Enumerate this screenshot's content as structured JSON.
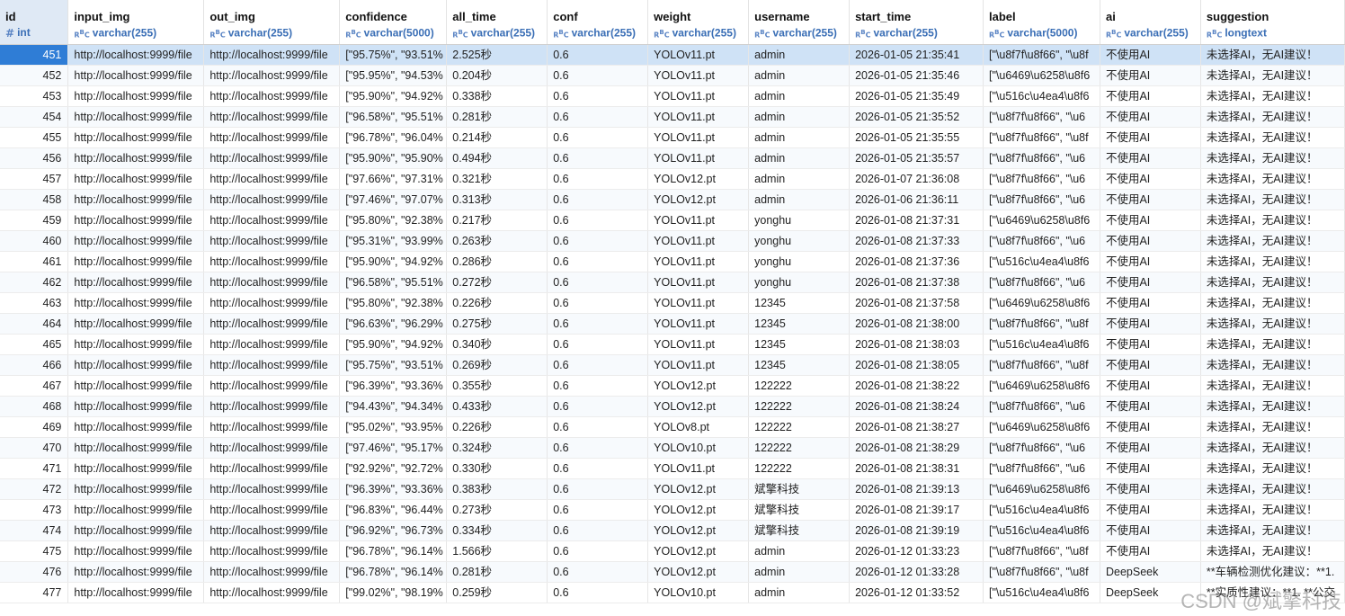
{
  "columns": [
    {
      "key": "id",
      "name": "id",
      "type": "int",
      "icon": "number-icon"
    },
    {
      "key": "input_img",
      "name": "input_img",
      "type": "varchar(255)",
      "icon": "text-type-icon"
    },
    {
      "key": "out_img",
      "name": "out_img",
      "type": "varchar(255)",
      "icon": "text-type-icon"
    },
    {
      "key": "confidence",
      "name": "confidence",
      "type": "varchar(5000)",
      "icon": "text-type-icon"
    },
    {
      "key": "all_time",
      "name": "all_time",
      "type": "varchar(255)",
      "icon": "text-type-icon"
    },
    {
      "key": "conf",
      "name": "conf",
      "type": "varchar(255)",
      "icon": "text-type-icon"
    },
    {
      "key": "weight",
      "name": "weight",
      "type": "varchar(255)",
      "icon": "text-type-icon"
    },
    {
      "key": "username",
      "name": "username",
      "type": "varchar(255)",
      "icon": "text-type-icon"
    },
    {
      "key": "start_time",
      "name": "start_time",
      "type": "varchar(255)",
      "icon": "text-type-icon"
    },
    {
      "key": "label",
      "name": "label",
      "type": "varchar(5000)",
      "icon": "text-type-icon"
    },
    {
      "key": "ai",
      "name": "ai",
      "type": "varchar(255)",
      "icon": "text-type-icon"
    },
    {
      "key": "suggestion",
      "name": "suggestion",
      "type": "longtext",
      "icon": "text-type-icon"
    }
  ],
  "selected_row_id": "451",
  "rows": [
    {
      "id": "451",
      "input_img": "http://localhost:9999/file",
      "out_img": "http://localhost:9999/file",
      "confidence": "[\"95.75%\", \"93.51%",
      "all_time": "2.525秒",
      "conf": "0.6",
      "weight": "YOLOv11.pt",
      "username": "admin",
      "start_time": "2026-01-05 21:35:41",
      "label": "[\"\\u8f7f\\u8f66\", \"\\u8f",
      "ai": "不使用AI",
      "suggestion": "未选择AI，无AI建议！"
    },
    {
      "id": "452",
      "input_img": "http://localhost:9999/file",
      "out_img": "http://localhost:9999/file",
      "confidence": "[\"95.95%\", \"94.53%",
      "all_time": "0.204秒",
      "conf": "0.6",
      "weight": "YOLOv11.pt",
      "username": "admin",
      "start_time": "2026-01-05 21:35:46",
      "label": "[\"\\u6469\\u6258\\u8f6",
      "ai": "不使用AI",
      "suggestion": "未选择AI，无AI建议！"
    },
    {
      "id": "453",
      "input_img": "http://localhost:9999/file",
      "out_img": "http://localhost:9999/file",
      "confidence": "[\"95.90%\", \"94.92%",
      "all_time": "0.338秒",
      "conf": "0.6",
      "weight": "YOLOv11.pt",
      "username": "admin",
      "start_time": "2026-01-05 21:35:49",
      "label": "[\"\\u516c\\u4ea4\\u8f6",
      "ai": "不使用AI",
      "suggestion": "未选择AI，无AI建议！"
    },
    {
      "id": "454",
      "input_img": "http://localhost:9999/file",
      "out_img": "http://localhost:9999/file",
      "confidence": "[\"96.58%\", \"95.51%",
      "all_time": "0.281秒",
      "conf": "0.6",
      "weight": "YOLOv11.pt",
      "username": "admin",
      "start_time": "2026-01-05 21:35:52",
      "label": "[\"\\u8f7f\\u8f66\", \"\\u6",
      "ai": "不使用AI",
      "suggestion": "未选择AI，无AI建议！"
    },
    {
      "id": "455",
      "input_img": "http://localhost:9999/file",
      "out_img": "http://localhost:9999/file",
      "confidence": "[\"96.78%\", \"96.04%",
      "all_time": "0.214秒",
      "conf": "0.6",
      "weight": "YOLOv11.pt",
      "username": "admin",
      "start_time": "2026-01-05 21:35:55",
      "label": "[\"\\u8f7f\\u8f66\", \"\\u8f",
      "ai": "不使用AI",
      "suggestion": "未选择AI，无AI建议！"
    },
    {
      "id": "456",
      "input_img": "http://localhost:9999/file",
      "out_img": "http://localhost:9999/file",
      "confidence": "[\"95.90%\", \"95.90%",
      "all_time": "0.494秒",
      "conf": "0.6",
      "weight": "YOLOv11.pt",
      "username": "admin",
      "start_time": "2026-01-05 21:35:57",
      "label": "[\"\\u8f7f\\u8f66\", \"\\u6",
      "ai": "不使用AI",
      "suggestion": "未选择AI，无AI建议！"
    },
    {
      "id": "457",
      "input_img": "http://localhost:9999/file",
      "out_img": "http://localhost:9999/file",
      "confidence": "[\"97.66%\", \"97.31%",
      "all_time": "0.321秒",
      "conf": "0.6",
      "weight": "YOLOv12.pt",
      "username": "admin",
      "start_time": "2026-01-07 21:36:08",
      "label": "[\"\\u8f7f\\u8f66\", \"\\u6",
      "ai": "不使用AI",
      "suggestion": "未选择AI，无AI建议！"
    },
    {
      "id": "458",
      "input_img": "http://localhost:9999/file",
      "out_img": "http://localhost:9999/file",
      "confidence": "[\"97.46%\", \"97.07%",
      "all_time": "0.313秒",
      "conf": "0.6",
      "weight": "YOLOv12.pt",
      "username": "admin",
      "start_time": "2026-01-06 21:36:11",
      "label": "[\"\\u8f7f\\u8f66\", \"\\u6",
      "ai": "不使用AI",
      "suggestion": "未选择AI，无AI建议！"
    },
    {
      "id": "459",
      "input_img": "http://localhost:9999/file",
      "out_img": "http://localhost:9999/file",
      "confidence": "[\"95.80%\", \"92.38%",
      "all_time": "0.217秒",
      "conf": "0.6",
      "weight": "YOLOv11.pt",
      "username": "yonghu",
      "start_time": "2026-01-08 21:37:31",
      "label": "[\"\\u6469\\u6258\\u8f6",
      "ai": "不使用AI",
      "suggestion": "未选择AI，无AI建议！"
    },
    {
      "id": "460",
      "input_img": "http://localhost:9999/file",
      "out_img": "http://localhost:9999/file",
      "confidence": "[\"95.31%\", \"93.99%",
      "all_time": "0.263秒",
      "conf": "0.6",
      "weight": "YOLOv11.pt",
      "username": "yonghu",
      "start_time": "2026-01-08 21:37:33",
      "label": "[\"\\u8f7f\\u8f66\", \"\\u6",
      "ai": "不使用AI",
      "suggestion": "未选择AI，无AI建议！"
    },
    {
      "id": "461",
      "input_img": "http://localhost:9999/file",
      "out_img": "http://localhost:9999/file",
      "confidence": "[\"95.90%\", \"94.92%",
      "all_time": "0.286秒",
      "conf": "0.6",
      "weight": "YOLOv11.pt",
      "username": "yonghu",
      "start_time": "2026-01-08 21:37:36",
      "label": "[\"\\u516c\\u4ea4\\u8f6",
      "ai": "不使用AI",
      "suggestion": "未选择AI，无AI建议！"
    },
    {
      "id": "462",
      "input_img": "http://localhost:9999/file",
      "out_img": "http://localhost:9999/file",
      "confidence": "[\"96.58%\", \"95.51%",
      "all_time": "0.272秒",
      "conf": "0.6",
      "weight": "YOLOv11.pt",
      "username": "yonghu",
      "start_time": "2026-01-08 21:37:38",
      "label": "[\"\\u8f7f\\u8f66\", \"\\u6",
      "ai": "不使用AI",
      "suggestion": "未选择AI，无AI建议！"
    },
    {
      "id": "463",
      "input_img": "http://localhost:9999/file",
      "out_img": "http://localhost:9999/file",
      "confidence": "[\"95.80%\", \"92.38%",
      "all_time": "0.226秒",
      "conf": "0.6",
      "weight": "YOLOv11.pt",
      "username": "12345",
      "start_time": "2026-01-08 21:37:58",
      "label": "[\"\\u6469\\u6258\\u8f6",
      "ai": "不使用AI",
      "suggestion": "未选择AI，无AI建议！"
    },
    {
      "id": "464",
      "input_img": "http://localhost:9999/file",
      "out_img": "http://localhost:9999/file",
      "confidence": "[\"96.63%\", \"96.29%",
      "all_time": "0.275秒",
      "conf": "0.6",
      "weight": "YOLOv11.pt",
      "username": "12345",
      "start_time": "2026-01-08 21:38:00",
      "label": "[\"\\u8f7f\\u8f66\", \"\\u8f",
      "ai": "不使用AI",
      "suggestion": "未选择AI，无AI建议！"
    },
    {
      "id": "465",
      "input_img": "http://localhost:9999/file",
      "out_img": "http://localhost:9999/file",
      "confidence": "[\"95.90%\", \"94.92%",
      "all_time": "0.340秒",
      "conf": "0.6",
      "weight": "YOLOv11.pt",
      "username": "12345",
      "start_time": "2026-01-08 21:38:03",
      "label": "[\"\\u516c\\u4ea4\\u8f6",
      "ai": "不使用AI",
      "suggestion": "未选择AI，无AI建议！"
    },
    {
      "id": "466",
      "input_img": "http://localhost:9999/file",
      "out_img": "http://localhost:9999/file",
      "confidence": "[\"95.75%\", \"93.51%",
      "all_time": "0.269秒",
      "conf": "0.6",
      "weight": "YOLOv11.pt",
      "username": "12345",
      "start_time": "2026-01-08 21:38:05",
      "label": "[\"\\u8f7f\\u8f66\", \"\\u8f",
      "ai": "不使用AI",
      "suggestion": "未选择AI，无AI建议！"
    },
    {
      "id": "467",
      "input_img": "http://localhost:9999/file",
      "out_img": "http://localhost:9999/file",
      "confidence": "[\"96.39%\", \"93.36%",
      "all_time": "0.355秒",
      "conf": "0.6",
      "weight": "YOLOv12.pt",
      "username": "122222",
      "start_time": "2026-01-08 21:38:22",
      "label": "[\"\\u6469\\u6258\\u8f6",
      "ai": "不使用AI",
      "suggestion": "未选择AI，无AI建议！"
    },
    {
      "id": "468",
      "input_img": "http://localhost:9999/file",
      "out_img": "http://localhost:9999/file",
      "confidence": "[\"94.43%\", \"94.34%",
      "all_time": "0.433秒",
      "conf": "0.6",
      "weight": "YOLOv12.pt",
      "username": "122222",
      "start_time": "2026-01-08 21:38:24",
      "label": "[\"\\u8f7f\\u8f66\", \"\\u6",
      "ai": "不使用AI",
      "suggestion": "未选择AI，无AI建议！"
    },
    {
      "id": "469",
      "input_img": "http://localhost:9999/file",
      "out_img": "http://localhost:9999/file",
      "confidence": "[\"95.02%\", \"93.95%",
      "all_time": "0.226秒",
      "conf": "0.6",
      "weight": "YOLOv8.pt",
      "username": "122222",
      "start_time": "2026-01-08 21:38:27",
      "label": "[\"\\u6469\\u6258\\u8f6",
      "ai": "不使用AI",
      "suggestion": "未选择AI，无AI建议！"
    },
    {
      "id": "470",
      "input_img": "http://localhost:9999/file",
      "out_img": "http://localhost:9999/file",
      "confidence": "[\"97.46%\", \"95.17%",
      "all_time": "0.324秒",
      "conf": "0.6",
      "weight": "YOLOv10.pt",
      "username": "122222",
      "start_time": "2026-01-08 21:38:29",
      "label": "[\"\\u8f7f\\u8f66\", \"\\u6",
      "ai": "不使用AI",
      "suggestion": "未选择AI，无AI建议！"
    },
    {
      "id": "471",
      "input_img": "http://localhost:9999/file",
      "out_img": "http://localhost:9999/file",
      "confidence": "[\"92.92%\", \"92.72%",
      "all_time": "0.330秒",
      "conf": "0.6",
      "weight": "YOLOv11.pt",
      "username": "122222",
      "start_time": "2026-01-08 21:38:31",
      "label": "[\"\\u8f7f\\u8f66\", \"\\u6",
      "ai": "不使用AI",
      "suggestion": "未选择AI，无AI建议！"
    },
    {
      "id": "472",
      "input_img": "http://localhost:9999/file",
      "out_img": "http://localhost:9999/file",
      "confidence": "[\"96.39%\", \"93.36%",
      "all_time": "0.383秒",
      "conf": "0.6",
      "weight": "YOLOv12.pt",
      "username": "斌擎科技",
      "start_time": "2026-01-08 21:39:13",
      "label": "[\"\\u6469\\u6258\\u8f6",
      "ai": "不使用AI",
      "suggestion": "未选择AI，无AI建议！"
    },
    {
      "id": "473",
      "input_img": "http://localhost:9999/file",
      "out_img": "http://localhost:9999/file",
      "confidence": "[\"96.83%\", \"96.44%",
      "all_time": "0.273秒",
      "conf": "0.6",
      "weight": "YOLOv12.pt",
      "username": "斌擎科技",
      "start_time": "2026-01-08 21:39:17",
      "label": "[\"\\u516c\\u4ea4\\u8f6",
      "ai": "不使用AI",
      "suggestion": "未选择AI，无AI建议！"
    },
    {
      "id": "474",
      "input_img": "http://localhost:9999/file",
      "out_img": "http://localhost:9999/file",
      "confidence": "[\"96.92%\", \"96.73%",
      "all_time": "0.334秒",
      "conf": "0.6",
      "weight": "YOLOv12.pt",
      "username": "斌擎科技",
      "start_time": "2026-01-08 21:39:19",
      "label": "[\"\\u516c\\u4ea4\\u8f6",
      "ai": "不使用AI",
      "suggestion": "未选择AI，无AI建议！"
    },
    {
      "id": "475",
      "input_img": "http://localhost:9999/file",
      "out_img": "http://localhost:9999/file",
      "confidence": "[\"96.78%\", \"96.14%",
      "all_time": "1.566秒",
      "conf": "0.6",
      "weight": "YOLOv12.pt",
      "username": "admin",
      "start_time": "2026-01-12 01:33:23",
      "label": "[\"\\u8f7f\\u8f66\", \"\\u8f",
      "ai": "不使用AI",
      "suggestion": "未选择AI，无AI建议！"
    },
    {
      "id": "476",
      "input_img": "http://localhost:9999/file",
      "out_img": "http://localhost:9999/file",
      "confidence": "[\"96.78%\", \"96.14%",
      "all_time": "0.281秒",
      "conf": "0.6",
      "weight": "YOLOv12.pt",
      "username": "admin",
      "start_time": "2026-01-12 01:33:28",
      "label": "[\"\\u8f7f\\u8f66\", \"\\u8f",
      "ai": "DeepSeek",
      "suggestion": "**车辆检测优化建议：**1."
    },
    {
      "id": "477",
      "input_img": "http://localhost:9999/file",
      "out_img": "http://localhost:9999/file",
      "confidence": "[\"99.02%\", \"98.19%",
      "all_time": "0.259秒",
      "conf": "0.6",
      "weight": "YOLOv10.pt",
      "username": "admin",
      "start_time": "2026-01-12 01:33:52",
      "label": "[\"\\u516c\\u4ea4\\u8f6",
      "ai": "DeepSeek",
      "suggestion": "**实质性建议：**1. **公交"
    }
  ],
  "watermark": "CSDN @斌擎科技"
}
